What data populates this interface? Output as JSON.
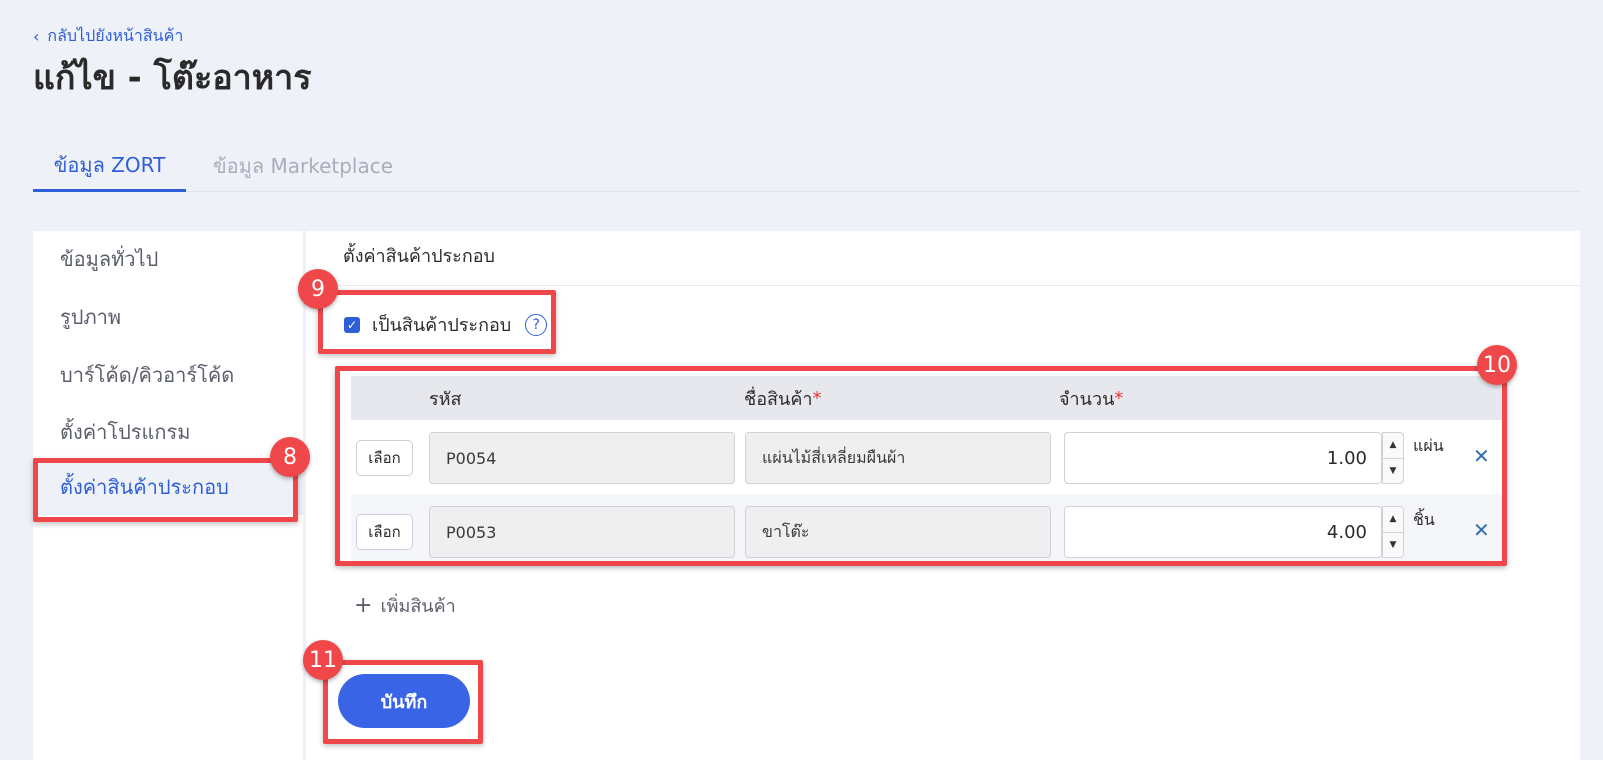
{
  "header": {
    "back_label": "กลับไปยังหน้าสินค้า",
    "title": "แก้ไข - โต๊ะอาหาร"
  },
  "tabs": [
    {
      "label": "ข้อมูล ZORT",
      "active": true
    },
    {
      "label": "ข้อมูล Marketplace",
      "active": false
    }
  ],
  "sidebar": {
    "items": [
      {
        "label": "ข้อมูลทั่วไป"
      },
      {
        "label": "รูปภาพ"
      },
      {
        "label": "บาร์โค้ด/คิวอาร์โค้ด"
      },
      {
        "label": "ตั้งค่าโปรแกรม"
      },
      {
        "label": "ตั้งค่าสินค้าประกอบ",
        "active": true
      }
    ]
  },
  "section": {
    "title": "ตั้งค่าสินค้าประกอบ",
    "checkbox_label": "เป็นสินค้าประกอบ",
    "checkbox_checked": true
  },
  "table": {
    "headers": {
      "code": "รหัส",
      "name": "ชื่อสินค้า",
      "qty": "จำนวน",
      "required_mark": "*"
    },
    "rows": [
      {
        "select_label": "เลือก",
        "code": "P0054",
        "name": "แผ่นไม้สี่เหลี่ยมผืนผ้า",
        "qty": "1.00",
        "unit": "แผ่น"
      },
      {
        "select_label": "เลือก",
        "code": "P0053",
        "name": "ขาโต๊ะ",
        "qty": "4.00",
        "unit": "ชิ้น"
      }
    ]
  },
  "add_item_label": "เพิ่มสินค้า",
  "save_label": "บันทึก",
  "annotations": [
    "8",
    "9",
    "10",
    "11"
  ],
  "colors": {
    "accent": "#2f5fd6",
    "highlight": "#f0474a",
    "save_button": "#3a64e6"
  }
}
